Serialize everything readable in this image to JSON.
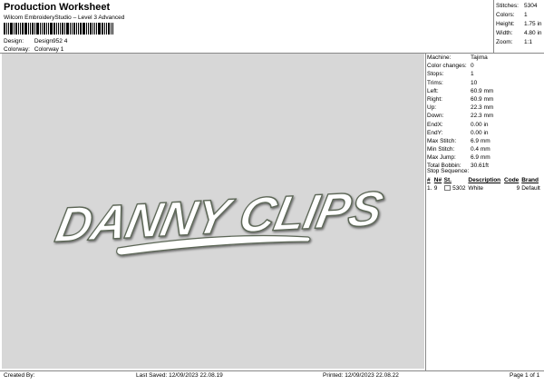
{
  "header": {
    "title": "Production Worksheet",
    "subtitle": "Wilcom EmbroideryStudio – Level 3 Advanced",
    "design_label": "Design:",
    "design_value": "Design952 4",
    "colorway_label": "Colorway:",
    "colorway_value": "Colorway 1"
  },
  "stats": [
    {
      "label": "Stitches:",
      "value": "5304"
    },
    {
      "label": "Colors:",
      "value": "1"
    },
    {
      "label": "Height:",
      "value": "1.75 in"
    },
    {
      "label": "Width:",
      "value": "4.80 in"
    },
    {
      "label": "Zoom:",
      "value": "1:1"
    }
  ],
  "info": [
    {
      "label": "Machine:",
      "value": "Tajima"
    },
    {
      "label": "Color changes:",
      "value": "0"
    },
    {
      "label": "Stops:",
      "value": "1"
    },
    {
      "label": "Trims:",
      "value": "10"
    },
    {
      "label": "Left:",
      "value": "60.9 mm"
    },
    {
      "label": "Right:",
      "value": "60.9 mm"
    },
    {
      "label": "Up:",
      "value": "22.3 mm"
    },
    {
      "label": "Down:",
      "value": "22.3 mm"
    },
    {
      "label": "EndX:",
      "value": "0.00 in"
    },
    {
      "label": "EndY:",
      "value": "0.00 in"
    },
    {
      "label": "Max Stitch:",
      "value": "6.9 mm"
    },
    {
      "label": "Min Stitch:",
      "value": "0.4 mm"
    },
    {
      "label": "Max Jump:",
      "value": "6.9 mm"
    },
    {
      "label": "Total Bobbin:",
      "value": "30.61ft"
    }
  ],
  "sequence": {
    "title": "Stop Sequence:",
    "headers": [
      "#",
      "N#",
      "St.",
      "Description",
      "Code",
      "Brand"
    ],
    "rows": [
      {
        "index": "1.",
        "n": "9",
        "stitches": "5302",
        "description": "White",
        "code": "9",
        "brand": "Default",
        "color": "#ffffff"
      }
    ]
  },
  "design": {
    "artwork_text": "DANNY CLIPS",
    "background": "#d7d7d7",
    "fill_color": "#ffffff",
    "outline_color": "#5b6656"
  },
  "footer": {
    "created_by": "Created By:",
    "last_saved": "Last Saved: 12/09/2023 22.08.19",
    "printed": "Printed: 12/09/2023 22.08.22",
    "page": "Page 1 of 1"
  }
}
